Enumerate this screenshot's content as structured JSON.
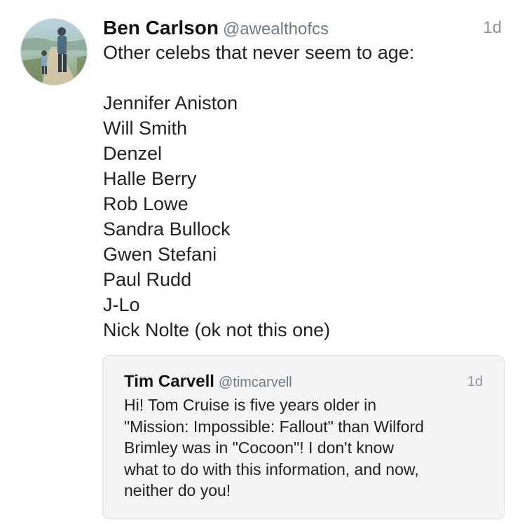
{
  "tweet": {
    "display_name": "Ben Carlson",
    "handle": "@awealthofcs",
    "timestamp": "1d",
    "avatar_icon": "profile-photo-icon",
    "lines": [
      "Other celebs that never seem to age:",
      "",
      "Jennifer Aniston",
      "Will Smith",
      "Denzel",
      "Halle Berry",
      "Rob Lowe",
      "Sandra Bullock",
      "Gwen Stefani",
      "Paul Rudd",
      "J-Lo",
      "Nick Nolte (ok not this one)"
    ]
  },
  "quoted_tweet": {
    "display_name": "Tim Carvell",
    "handle": "@timcarvell",
    "timestamp": "1d",
    "lines": [
      "Hi! Tom Cruise is five years older in",
      "\"Mission: Impossible: Fallout\" than Wilford",
      "Brimley was in \"Cocoon\"! I don't know",
      "what to do with this information, and now,",
      "neither do you!"
    ]
  },
  "colors": {
    "name": "#111111",
    "handle": "#6e7a84",
    "timestamp": "#8a949c",
    "quote_background": "#f4f4f4",
    "quote_border": "#dedede"
  }
}
